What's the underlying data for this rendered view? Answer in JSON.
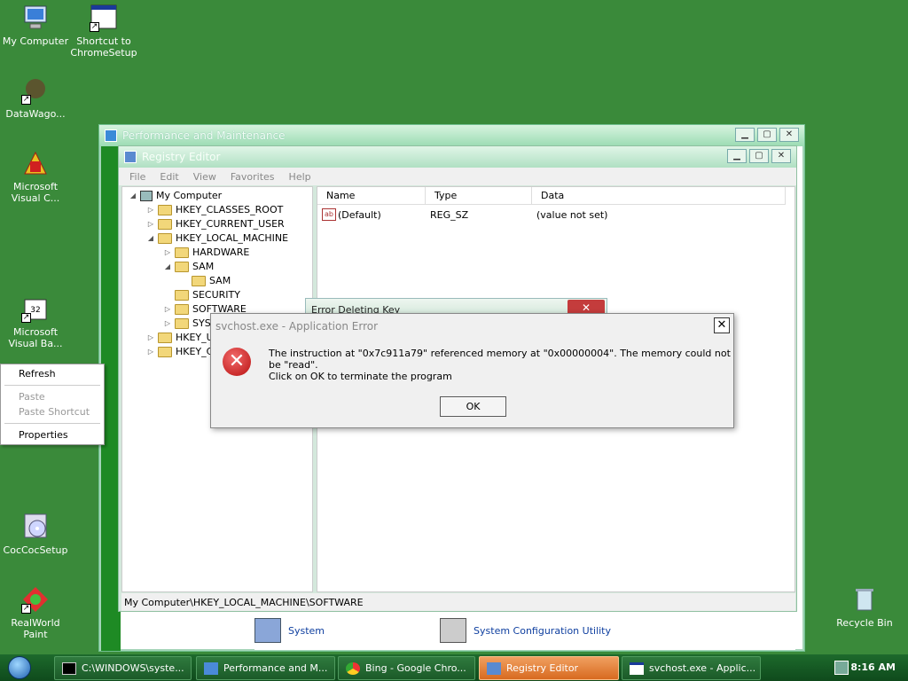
{
  "desktop": {
    "icons": [
      {
        "label": "My Computer"
      },
      {
        "label": "Shortcut to ChromeSetup"
      },
      {
        "label": "DataWago..."
      },
      {
        "label": "Microsoft Visual C..."
      },
      {
        "label": "Microsoft Visual Ba..."
      },
      {
        "label": "CocCocSetup"
      },
      {
        "label": "RealWorld Paint"
      },
      {
        "label": "Recycle Bin"
      }
    ]
  },
  "perf_window": {
    "title": "Performance and Maintenance",
    "bottom_items": [
      "System",
      "System Configuration Utility"
    ]
  },
  "regedit": {
    "title": "Registry Editor",
    "menu": [
      "File",
      "Edit",
      "View",
      "Favorites",
      "Help"
    ],
    "tree": {
      "root": "My Computer",
      "nodes": [
        "HKEY_CLASSES_ROOT",
        "HKEY_CURRENT_USER",
        "HKEY_LOCAL_MACHINE",
        "HARDWARE",
        "SAM",
        "SAM",
        "SECURITY",
        "SOFTWARE",
        "SYST",
        "HKEY_U",
        "HKEY_C"
      ]
    },
    "columns": [
      "Name",
      "Type",
      "Data"
    ],
    "rows": [
      {
        "name": "(Default)",
        "type": "REG_SZ",
        "data": "(value not set)"
      }
    ],
    "status": "My Computer\\HKEY_LOCAL_MACHINE\\SOFTWARE"
  },
  "error_deleting": {
    "title": "Error Deleting Key"
  },
  "app_error": {
    "title": "svchost.exe - Application Error",
    "message": "The instruction at \"0x7c911a79\" referenced memory at \"0x00000004\". The memory could not be \"read\".",
    "message2": "Click on OK to terminate the program",
    "ok_label": "OK"
  },
  "context_menu": {
    "items": [
      "Refresh",
      "Paste",
      "Paste Shortcut",
      "Properties"
    ]
  },
  "taskbar": {
    "buttons": [
      {
        "label": "C:\\WINDOWS\\syste..."
      },
      {
        "label": "Performance and M..."
      },
      {
        "label": "Bing - Google Chro..."
      },
      {
        "label": "Registry Editor"
      },
      {
        "label": "svchost.exe - Applic..."
      }
    ],
    "clock": "8:16 AM"
  },
  "colors": {
    "desktop": "#3a8a3a",
    "taskbar": "#1b5a28",
    "active_task": "#e07a2c",
    "error_red": "#c41414"
  }
}
